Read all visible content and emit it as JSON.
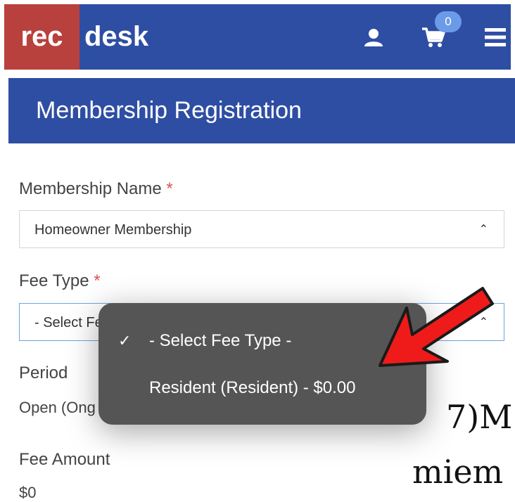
{
  "brand": {
    "logo_rec": "rec",
    "logo_desk": "desk"
  },
  "topbar": {
    "cart_count": "0"
  },
  "page": {
    "title": "Membership Registration"
  },
  "form": {
    "membership_name": {
      "label": "Membership Name",
      "required_mark": "*",
      "value": "Homeowner Membership"
    },
    "fee_type": {
      "label": "Fee Type",
      "required_mark": "*",
      "value": "- Select Fe"
    },
    "period": {
      "label": "Period",
      "value": "Open (Ong"
    },
    "fee_amount": {
      "label": "Fee Amount",
      "value": "$0"
    }
  },
  "dropdown": {
    "options": [
      {
        "label": "- Select Fee Type -",
        "selected": true
      },
      {
        "label": "Resident (Resident) - $0.00",
        "selected": false
      }
    ]
  },
  "annotation": {
    "line1": "7)M",
    "line2": "miem"
  },
  "colors": {
    "brand_blue": "#2e4ea3",
    "logo_red": "#b8413d",
    "arrow_red": "#ef1b1b",
    "required_red": "#d9534f"
  }
}
